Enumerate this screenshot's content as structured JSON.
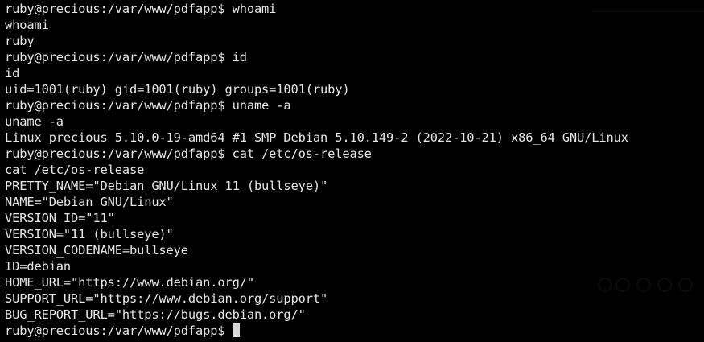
{
  "terminal": {
    "prompt": "ruby@precious:/var/www/pdfapp$",
    "lines": [
      "ruby@precious:/var/www/pdfapp$ whoami",
      "whoami",
      "ruby",
      "ruby@precious:/var/www/pdfapp$ id",
      "id",
      "uid=1001(ruby) gid=1001(ruby) groups=1001(ruby)",
      "ruby@precious:/var/www/pdfapp$ uname -a",
      "uname -a",
      "Linux precious 5.10.0-19-amd64 #1 SMP Debian 5.10.149-2 (2022-10-21) x86_64 GNU/Linux",
      "ruby@precious:/var/www/pdfapp$ cat /etc/os-release",
      "cat /etc/os-release",
      "PRETTY_NAME=\"Debian GNU/Linux 11 (bullseye)\"",
      "NAME=\"Debian GNU/Linux\"",
      "VERSION_ID=\"11\"",
      "VERSION=\"11 (bullseye)\"",
      "VERSION_CODENAME=bullseye",
      "ID=debian",
      "HOME_URL=\"https://www.debian.org/\"",
      "SUPPORT_URL=\"https://www.debian.org/support\"",
      "BUG_REPORT_URL=\"https://bugs.debian.org/\""
    ],
    "current_prompt": "ruby@precious:/var/www/pdfapp$ ",
    "colors": {
      "background": "#000000",
      "text": "#e6e6e6",
      "cursor": "#d8d8d8"
    }
  }
}
